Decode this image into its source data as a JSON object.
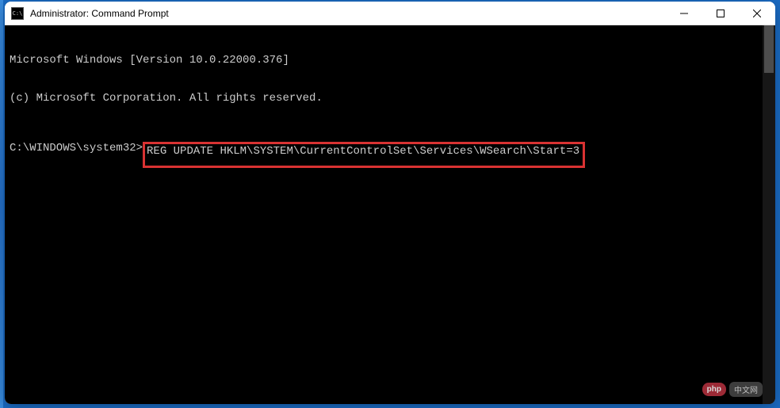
{
  "window": {
    "title": "Administrator: Command Prompt",
    "icon_label": "CMD"
  },
  "terminal": {
    "line1": "Microsoft Windows [Version 10.0.22000.376]",
    "line2": "(c) Microsoft Corporation. All rights reserved.",
    "prompt": "C:\\WINDOWS\\system32>",
    "command": "REG UPDATE HKLM\\SYSTEM\\CurrentControlSet\\Services\\WSearch\\Start=3"
  },
  "watermark": {
    "badge": "php",
    "text": "中文网"
  }
}
